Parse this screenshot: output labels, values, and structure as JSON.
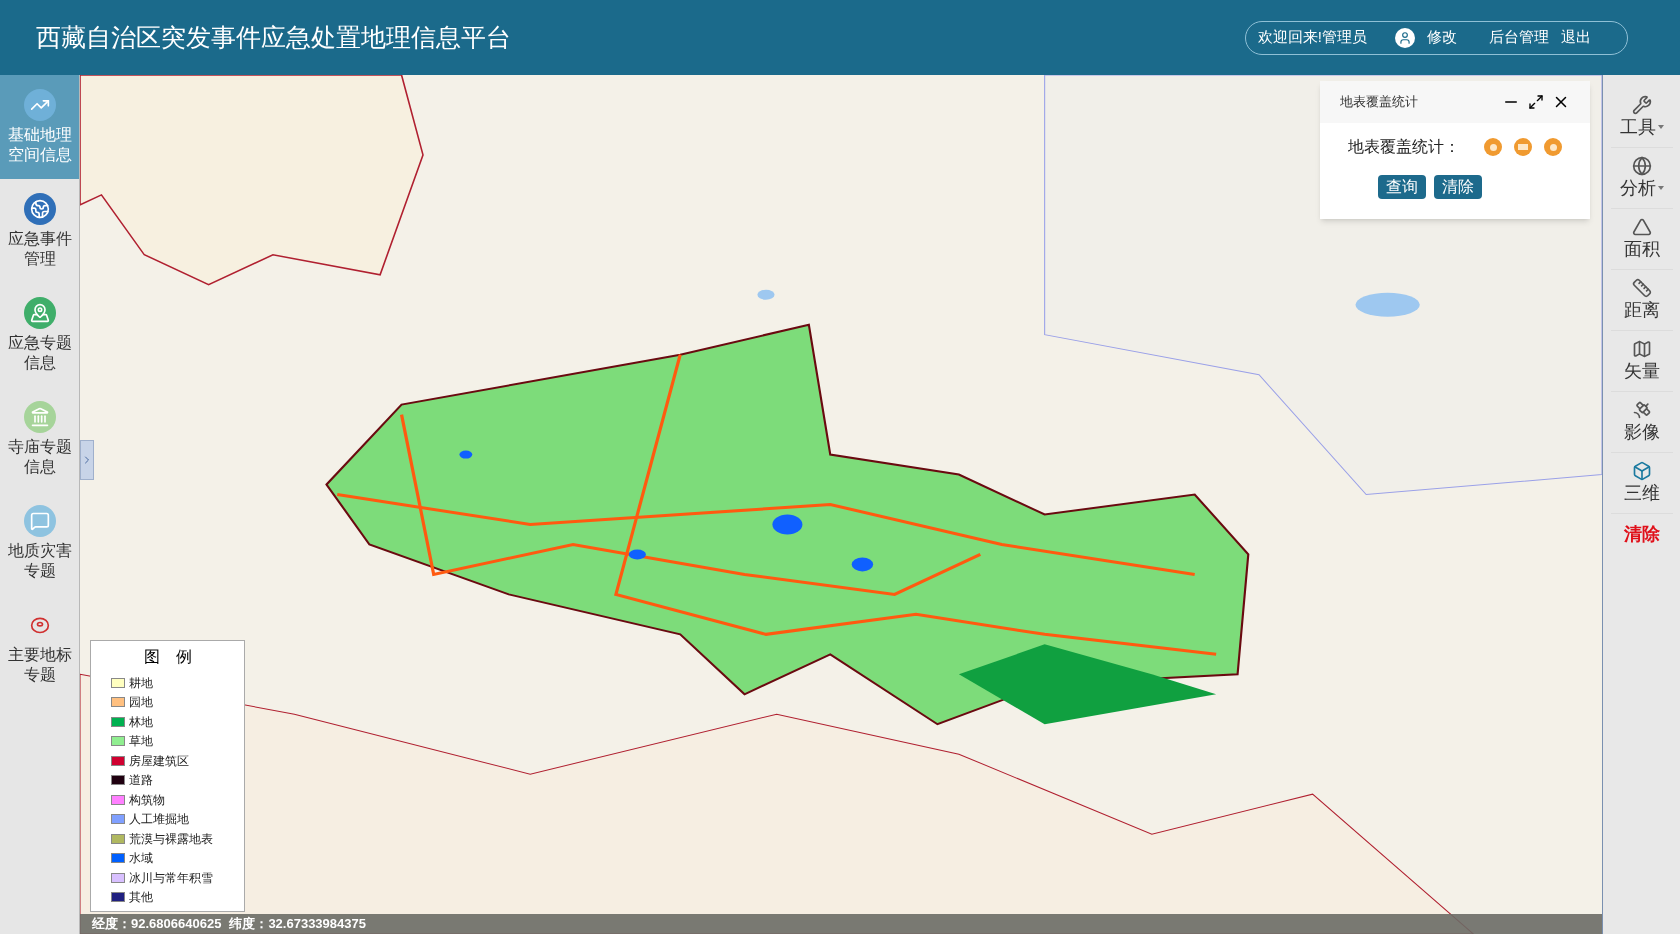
{
  "header": {
    "title": "西藏自治区突发事件应急处置地理信息平台",
    "welcome": "欢迎回来!管理员",
    "edit": "修改",
    "admin": "后台管理",
    "logout": "退出"
  },
  "sidebar": {
    "items": [
      {
        "label": "基础地理空间信息",
        "selected": true
      },
      {
        "label": "应急事件管理",
        "selected": false
      },
      {
        "label": "应急专题信息",
        "selected": false
      },
      {
        "label": "寺庙专题信息",
        "selected": false
      },
      {
        "label": "地质灾害专题",
        "selected": false
      },
      {
        "label": "主要地标专题",
        "selected": false
      }
    ]
  },
  "toolbar": {
    "items": [
      {
        "label": "工具",
        "kind": "menu"
      },
      {
        "label": "分析",
        "kind": "menu"
      },
      {
        "label": "面积",
        "kind": "tool"
      },
      {
        "label": "距离",
        "kind": "tool"
      },
      {
        "label": "矢量",
        "kind": "tool"
      },
      {
        "label": "影像",
        "kind": "tool"
      },
      {
        "label": "三维",
        "kind": "tool"
      },
      {
        "label": "清除",
        "kind": "danger"
      }
    ]
  },
  "dialog": {
    "title": "地表覆盖统计",
    "label": "地表覆盖统计：",
    "buttons": [
      "查询",
      "清除"
    ]
  },
  "legend": {
    "title": "图　例",
    "items": [
      {
        "label": "耕地",
        "color": "#ffffc0"
      },
      {
        "label": "园地",
        "color": "#ffc080"
      },
      {
        "label": "林地",
        "color": "#00b050"
      },
      {
        "label": "草地",
        "color": "#90ee90"
      },
      {
        "label": "房屋建筑区",
        "color": "#d00030"
      },
      {
        "label": "道路",
        "color": "#200010"
      },
      {
        "label": "构筑物",
        "color": "#ff80ff"
      },
      {
        "label": "人工堆掘地",
        "color": "#80a0ff"
      },
      {
        "label": "荒漠与裸露地表",
        "color": "#b0b860"
      },
      {
        "label": "水域",
        "color": "#0060ff"
      },
      {
        "label": "冰川与常年积雪",
        "color": "#d8c0ff"
      },
      {
        "label": "其他",
        "color": "#202080"
      }
    ]
  },
  "status_bar": {
    "longitude": "经度：92.6806640625",
    "latitude": "纬度：32.67333984375"
  }
}
